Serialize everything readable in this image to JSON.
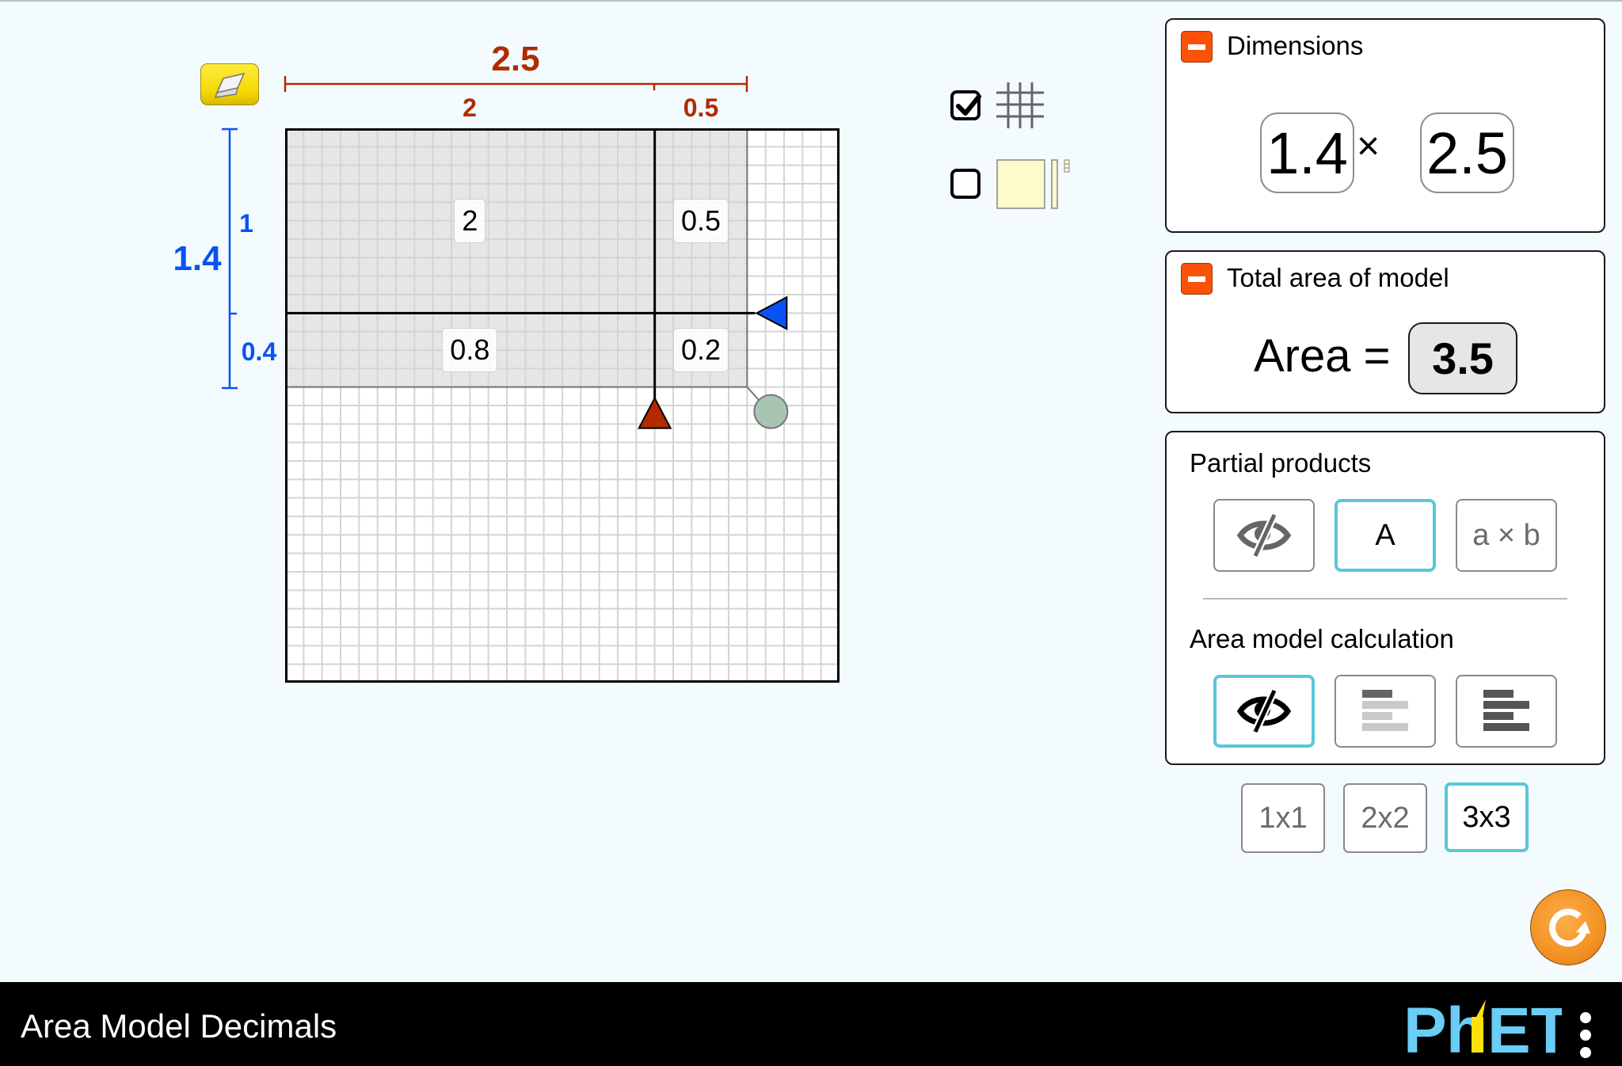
{
  "app_title": "Area Model Decimals",
  "colors": {
    "width_color": "#b22a00",
    "height_color": "#0b52f2",
    "highlight": "#5bc6d8",
    "minus_button": "#fa5208",
    "background": "#f3fbfe"
  },
  "model": {
    "grid_size_units": 3,
    "width": 2.5,
    "height": 1.4,
    "width_partitions": [
      2,
      0.5
    ],
    "height_partitions": [
      1,
      0.4
    ],
    "top_ruler": {
      "total_label": "2.5",
      "part_labels": [
        "2",
        "0.5"
      ]
    },
    "left_ruler": {
      "total_label": "1.4",
      "part_labels": [
        "1",
        "0.4"
      ]
    },
    "partial_products": [
      {
        "label": "2"
      },
      {
        "label": "0.5"
      },
      {
        "label": "0.8"
      },
      {
        "label": "0.2"
      }
    ]
  },
  "toggles": {
    "grid_lines": {
      "icon": "grid-icon",
      "checked": true
    },
    "tiles": {
      "icon": "tiles-icon",
      "checked": false
    }
  },
  "dimensions_panel": {
    "title": "Dimensions",
    "height_value": "1.4",
    "times": "×",
    "width_value": "2.5"
  },
  "total_area_panel": {
    "title": "Total area of model",
    "area_label": "Area =",
    "area_value": "3.5"
  },
  "partial_products_panel": {
    "title": "Partial products",
    "options": [
      {
        "name": "hidden",
        "icon": "eye-hidden-icon",
        "label": "",
        "selected": false
      },
      {
        "name": "area",
        "label": "A",
        "selected": true
      },
      {
        "name": "dimensions",
        "label": "a × b",
        "selected": false
      }
    ]
  },
  "calculation_panel": {
    "title": "Area model calculation",
    "options": [
      {
        "name": "hidden",
        "icon": "eye-hidden-icon",
        "selected": true
      },
      {
        "name": "line-by-line",
        "icon": "line-by-line-icon",
        "selected": false
      },
      {
        "name": "all-lines",
        "icon": "all-lines-icon",
        "selected": false
      }
    ]
  },
  "grid_size_buttons": [
    {
      "label": "1x1",
      "selected": false
    },
    {
      "label": "2x2",
      "selected": false
    },
    {
      "label": "3x3",
      "selected": true
    }
  ],
  "footer": {
    "brand": "PhET"
  }
}
